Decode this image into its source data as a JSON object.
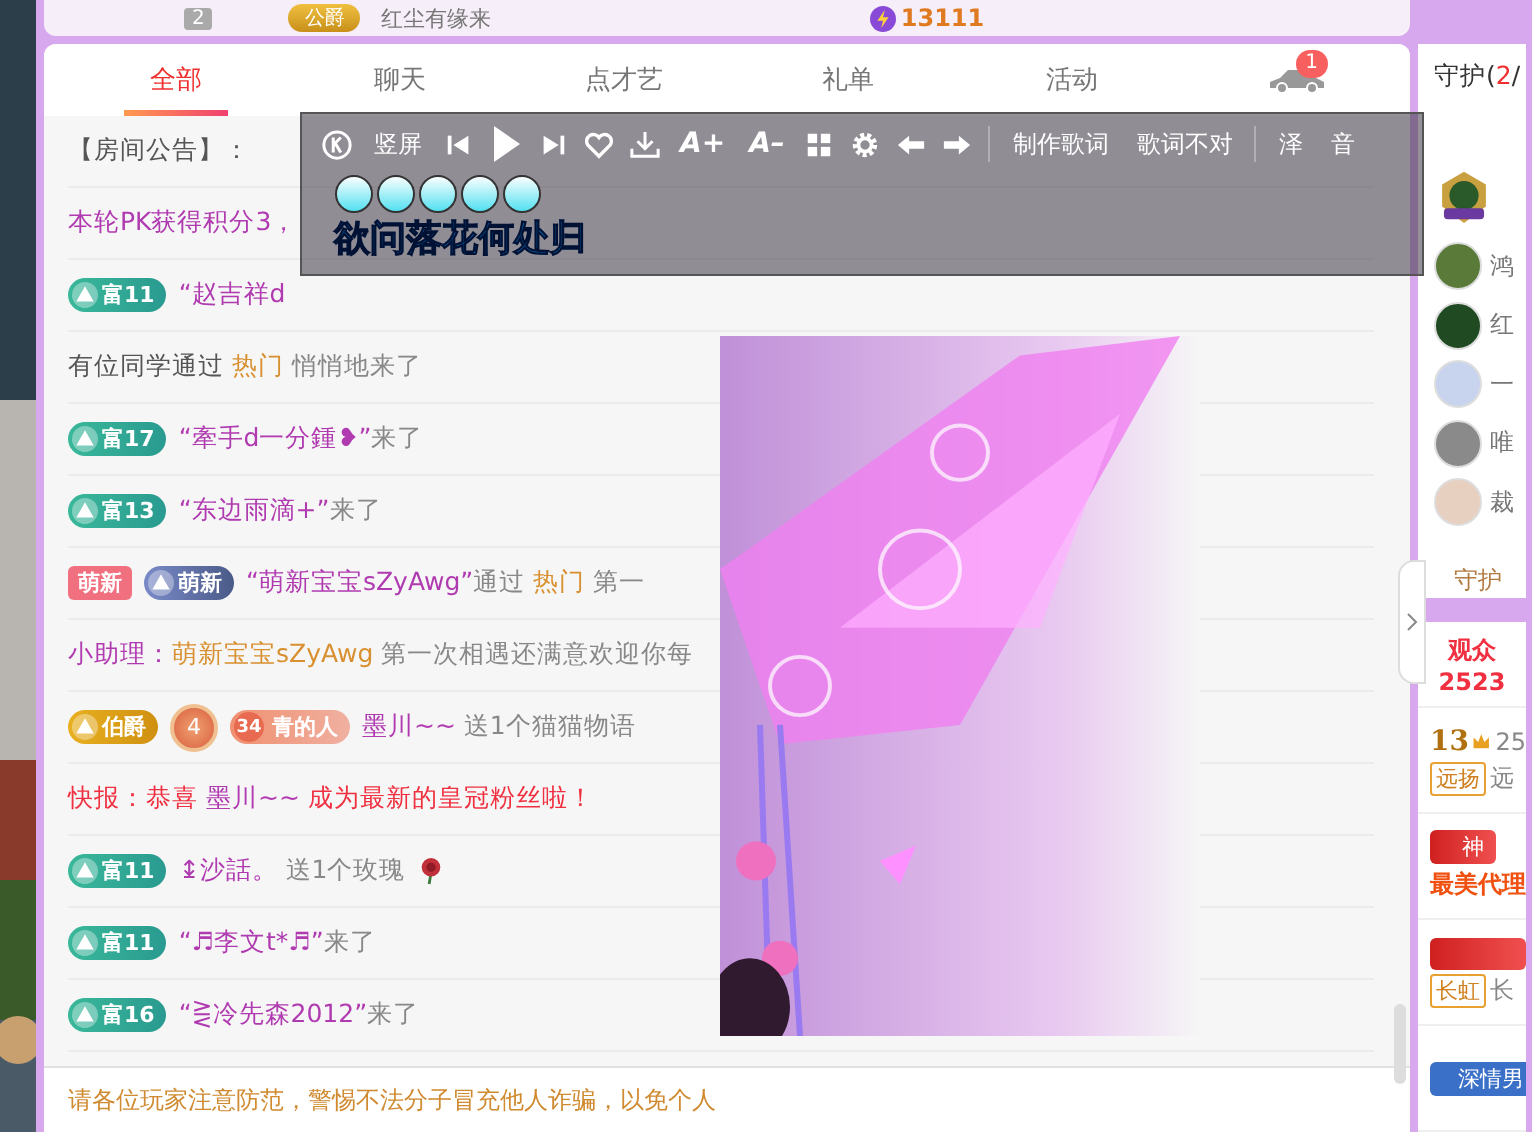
{
  "top_card": {
    "rank": "2",
    "title_badge": "公爵",
    "name": "红尘有缘来",
    "score": "13111"
  },
  "tabs": [
    {
      "label": "全部",
      "selected": true
    },
    {
      "label": "聊天",
      "selected": false
    },
    {
      "label": "点才艺",
      "selected": false
    },
    {
      "label": "礼单",
      "selected": false
    },
    {
      "label": "活动",
      "selected": false
    }
  ],
  "car_tab": {
    "badge": "1",
    "selected": false
  },
  "lyrics_bar": {
    "buttons": [
      {
        "kind": "k-logo"
      },
      {
        "kind": "text",
        "label": "竖屏"
      },
      {
        "kind": "prev"
      },
      {
        "kind": "play"
      },
      {
        "kind": "next"
      },
      {
        "kind": "heart"
      },
      {
        "kind": "download"
      },
      {
        "kind": "big",
        "label": "A+"
      },
      {
        "kind": "big",
        "label": "A–"
      },
      {
        "kind": "grid"
      },
      {
        "kind": "gear"
      },
      {
        "kind": "left"
      },
      {
        "kind": "right"
      },
      {
        "kind": "divider"
      },
      {
        "kind": "text",
        "label": "制作歌词"
      },
      {
        "kind": "text",
        "label": "歌词不对"
      },
      {
        "kind": "divider"
      },
      {
        "kind": "text",
        "label": "泽"
      },
      {
        "kind": "text",
        "label": "音"
      }
    ],
    "lyric": "欲问落花何处归"
  },
  "chat_rows": [
    {
      "badges": [],
      "segments": [
        {
          "text": "【房间公告】：",
          "kind": "plain"
        }
      ]
    },
    {
      "badges": [],
      "segments": [
        {
          "text": "本轮PK获得积分3，",
          "kind": "name"
        }
      ]
    },
    {
      "badges": [
        {
          "kind": "rich",
          "label": "富11"
        }
      ],
      "segments": [
        {
          "text": "“赵吉祥d",
          "kind": "name"
        }
      ]
    },
    {
      "badges": [],
      "segments": [
        {
          "text": "有位同学通过 ",
          "kind": "plain"
        },
        {
          "text": "热门",
          "kind": "hot"
        },
        {
          "text": " 悄悄地来了",
          "kind": "muted"
        }
      ]
    },
    {
      "badges": [
        {
          "kind": "rich",
          "label": "富17"
        }
      ],
      "segments": [
        {
          "text": "“牽手d一分鍾❥”",
          "kind": "name"
        },
        {
          "text": "来了",
          "kind": "muted"
        }
      ]
    },
    {
      "badges": [
        {
          "kind": "rich",
          "label": "富13"
        }
      ],
      "segments": [
        {
          "text": "“东边雨滴+”",
          "kind": "name"
        },
        {
          "text": "来了",
          "kind": "muted"
        }
      ]
    },
    {
      "badges": [
        {
          "kind": "newbie",
          "label": "萌新"
        },
        {
          "kind": "newbie-level",
          "label": "萌新"
        }
      ],
      "segments": [
        {
          "text": "“萌新宝宝sZyAwg”",
          "kind": "name"
        },
        {
          "text": "通过 ",
          "kind": "muted"
        },
        {
          "text": "热门",
          "kind": "hot"
        },
        {
          "text": " 第一",
          "kind": "muted"
        }
      ]
    },
    {
      "badges": [],
      "segments": [
        {
          "text": "小助理：",
          "kind": "name"
        },
        {
          "text": "萌新宝宝sZyAwg",
          "kind": "hot"
        },
        {
          "text": " 第一次相遇还满意欢迎你每",
          "kind": "muted"
        }
      ]
    },
    {
      "badges": [
        {
          "kind": "noble",
          "label": "伯爵"
        },
        {
          "kind": "medal",
          "label": "4"
        },
        {
          "kind": "fan",
          "number": "34",
          "label": "青的人"
        }
      ],
      "segments": [
        {
          "text": "墨川~~ ",
          "kind": "name"
        },
        {
          "text": "送1个猫猫物语",
          "kind": "muted"
        }
      ]
    },
    {
      "badges": [],
      "segments": [
        {
          "text": "快报：恭喜 ",
          "kind": "alert"
        },
        {
          "text": "墨川~~ ",
          "kind": "name"
        },
        {
          "text": "成为最新的皇冠粉丝啦！",
          "kind": "alert"
        }
      ]
    },
    {
      "badges": [
        {
          "kind": "rich",
          "label": "富11"
        }
      ],
      "segments": [
        {
          "text": "↨沙話。",
          "kind": "name"
        },
        {
          "text": " 送1个玫瑰",
          "kind": "muted"
        }
      ],
      "kind": "gift"
    },
    {
      "badges": [
        {
          "kind": "rich",
          "label": "富11"
        }
      ],
      "segments": [
        {
          "text": "“♬李文t*♬”",
          "kind": "name"
        },
        {
          "text": "来了",
          "kind": "muted"
        }
      ]
    },
    {
      "badges": [
        {
          "kind": "rich",
          "label": "富16"
        }
      ],
      "segments": [
        {
          "text": "“⋛冷先森2012”",
          "kind": "name"
        },
        {
          "text": "来了",
          "kind": "muted"
        }
      ]
    }
  ],
  "footer_notice": "请各位玩家注意防范，警惕不法分子冒充他人诈骗，以免个人",
  "guard_panel": {
    "title": "守护(",
    "count": "2",
    "rest": "/",
    "guardians": [
      {
        "name": "鸿",
        "color": "#5a7a3a"
      },
      {
        "name": "红",
        "color": "#1f4a22"
      },
      {
        "name": "一",
        "color": "#c8d4ee"
      },
      {
        "name": "唯",
        "color": "#8a8a8a"
      },
      {
        "name": "裁",
        "color": "#e8d0c0"
      }
    ],
    "button": "守护"
  },
  "audience": {
    "label": "观众",
    "count": "2523",
    "viewers": [
      {
        "kind": "ranked",
        "level": "13",
        "extra": "25",
        "tag": "远扬",
        "name": "远"
      },
      {
        "kind": "titled",
        "title": "神",
        "name": "最美代理"
      },
      {
        "kind": "titled-tag",
        "tag": "长虹",
        "name": "长"
      },
      {
        "kind": "banner",
        "tag": "深情男"
      }
    ]
  }
}
